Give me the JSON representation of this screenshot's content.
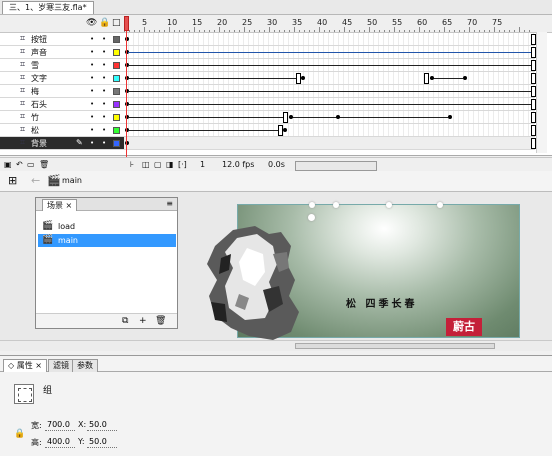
{
  "document": {
    "tab_label": "三、1、岁寒三友.fla*"
  },
  "timeline": {
    "frame_numbers": [
      "5",
      "10",
      "15",
      "20",
      "25",
      "30",
      "35",
      "40",
      "45",
      "50",
      "55",
      "60",
      "65",
      "70",
      "75"
    ],
    "layers": [
      {
        "name": "按钮",
        "color": "#666666",
        "selected": false
      },
      {
        "name": "声音",
        "color": "#ffff00",
        "selected": false
      },
      {
        "name": "雪",
        "color": "#ff3333",
        "selected": false
      },
      {
        "name": "文字",
        "color": "#33ffff",
        "selected": false
      },
      {
        "name": "梅",
        "color": "#777777",
        "selected": false
      },
      {
        "name": "石头",
        "color": "#9933ff",
        "selected": false
      },
      {
        "name": "竹",
        "color": "#ffff00",
        "selected": false
      },
      {
        "name": "松",
        "color": "#33ff33",
        "selected": false
      },
      {
        "name": "背景",
        "color": "#3366ff",
        "selected": true
      }
    ],
    "current_frame": "1",
    "fps": "12.0 fps",
    "time": "0.0s"
  },
  "editbar": {
    "scene": "main"
  },
  "scene_panel": {
    "tab_label": "场景",
    "items": [
      {
        "label": "load",
        "selected": false
      },
      {
        "label": "main",
        "selected": true
      }
    ]
  },
  "stage": {
    "poem": "松  四季长春",
    "seal": "蔚古"
  },
  "properties": {
    "tabs": [
      "属性",
      "滤镜",
      "参数"
    ],
    "type_label": "组",
    "width_label": "宽:",
    "width_value": "700.0",
    "height_label": "高:",
    "height_value": "400.0",
    "x_label": "X:",
    "x_value": "50.0",
    "y_label": "Y:",
    "y_value": "50.0"
  },
  "colors": {
    "selection": "#3399ff",
    "playhead": "#e33333",
    "seal": "#c42039"
  }
}
